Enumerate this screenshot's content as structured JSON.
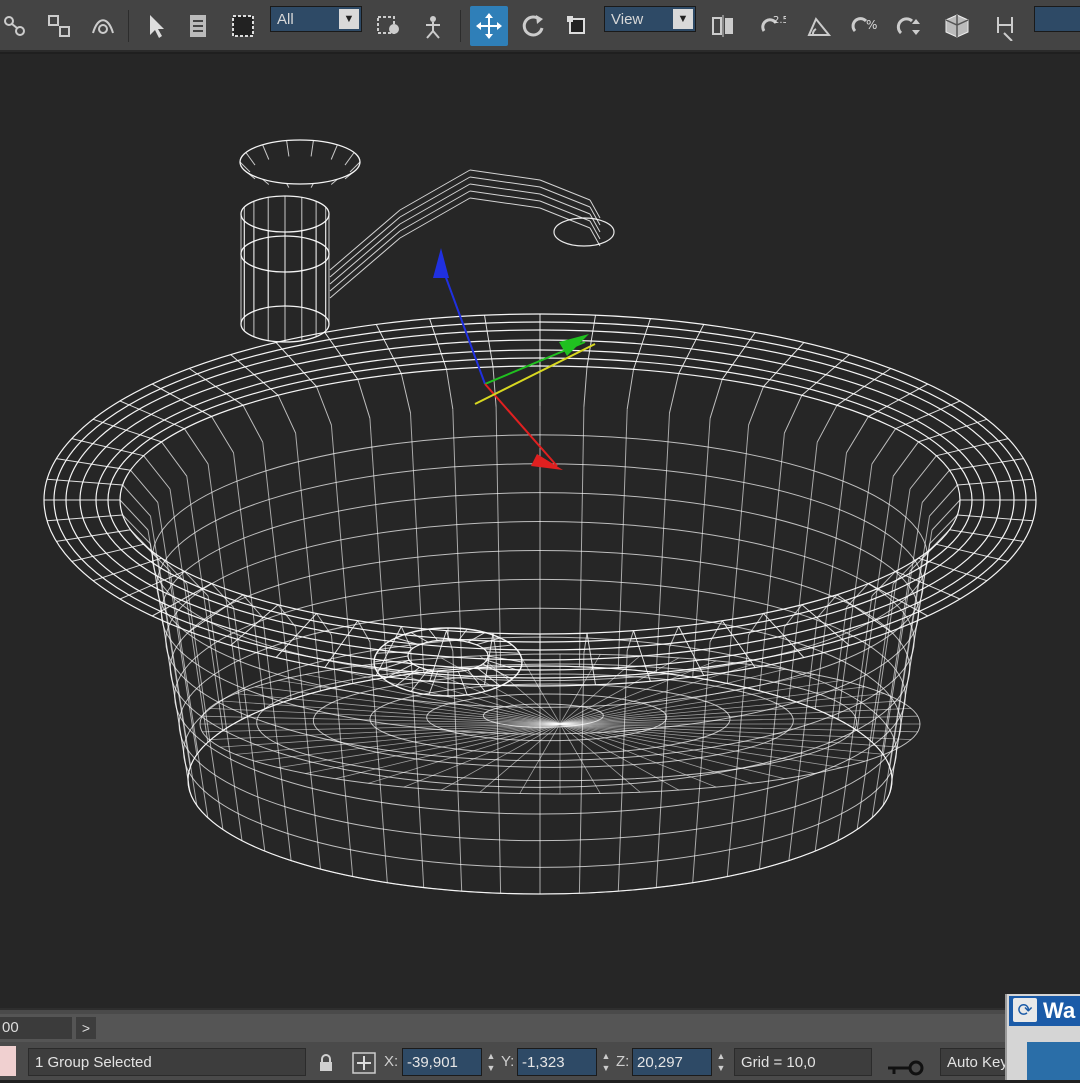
{
  "toolbar": {
    "selection_filter": "All",
    "reference_coord": "View",
    "snap_label": "2.5",
    "icons": [
      "link-icon",
      "unlink-icon",
      "bind-space-warp-icon",
      "select-object-icon",
      "select-by-name-icon",
      "rectangular-selection-icon",
      "window-crossing-icon",
      "select-and-move-icon",
      "select-and-rotate-icon",
      "select-and-scale-icon",
      "use-pivot-center-icon",
      "mirror-icon",
      "snaps-toggle-icon",
      "angle-snap-icon",
      "percent-snap-icon",
      "spinner-snap-icon",
      "named-selection-icon",
      "abc-icon"
    ]
  },
  "timeline": {
    "frame_text": "00",
    "next_label": ">"
  },
  "status_bar": {
    "selection_text": "1 Group Selected",
    "x_label": "X:",
    "x_value": "-39,901",
    "y_label": "Y:",
    "y_value": "-1,323",
    "z_label": "Z:",
    "z_value": "20,297",
    "grid_text": "Grid = 10,0",
    "autokey_label": "Auto Key"
  },
  "floating_panel": {
    "title": "Wa"
  },
  "colors": {
    "toolbar_bg": "#444444",
    "viewport_bg": "#262626",
    "wireframe": "#ffffff",
    "active_tool": "#2f7fb8",
    "axis_x": "#e02020",
    "axis_y": "#20c020",
    "axis_z": "#2030e0"
  }
}
